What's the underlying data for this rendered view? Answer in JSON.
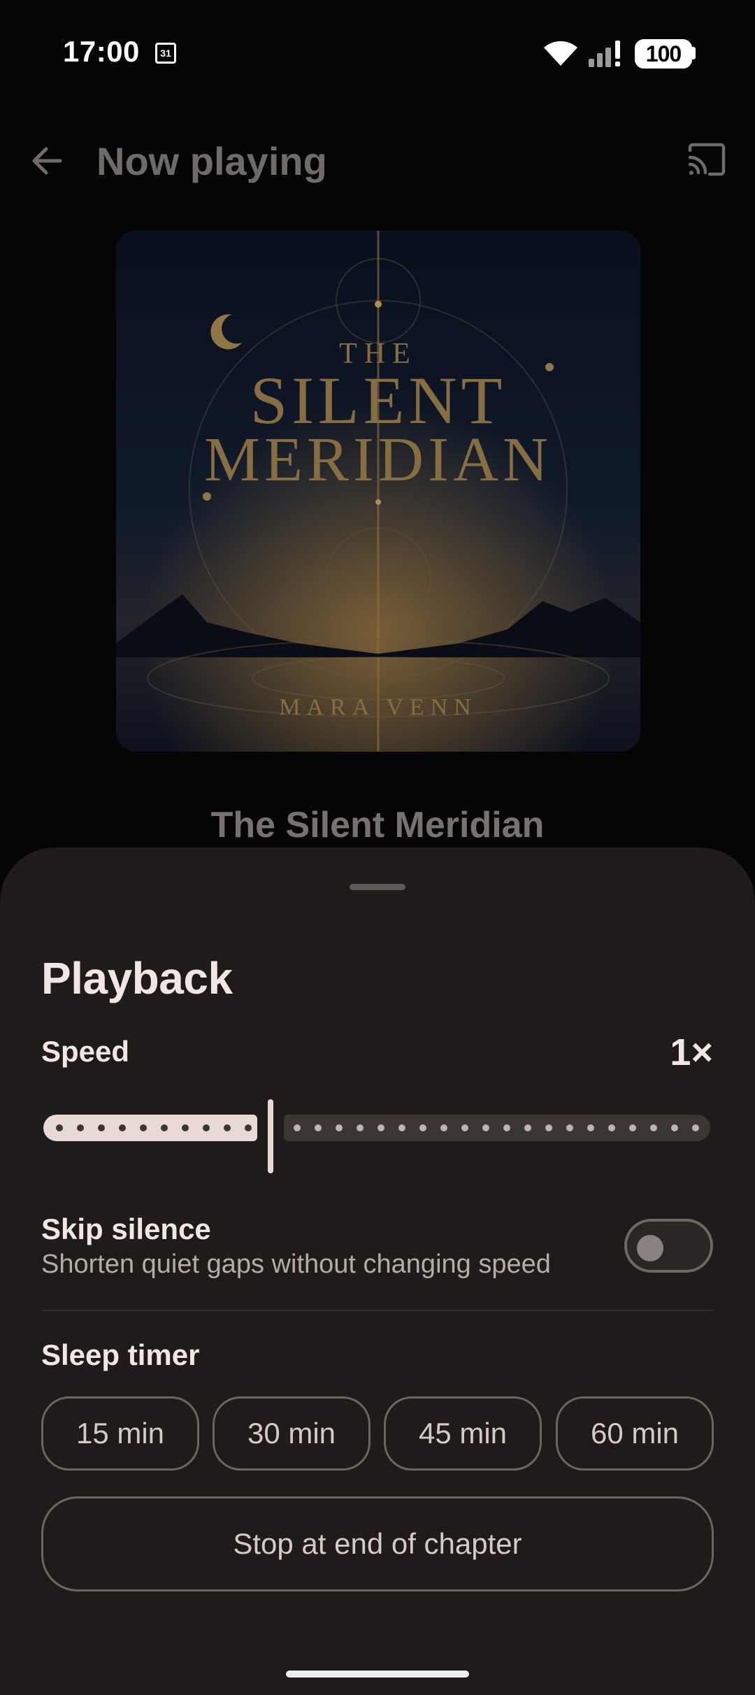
{
  "status_bar": {
    "time": "17:00",
    "calendar_day": "31",
    "battery": "100",
    "icons": [
      "calendar-icon",
      "wifi-icon",
      "signal-icon",
      "battery-icon"
    ]
  },
  "header": {
    "title": "Now playing",
    "back_icon": "arrow-back-icon",
    "cast_icon": "cast-icon"
  },
  "book": {
    "cover_line_1": "THE",
    "cover_line_2": "SILENT",
    "cover_line_3": "MERIDIAN",
    "cover_author": "MARA VENN",
    "title": "The Silent Meridian"
  },
  "playback_sheet": {
    "title": "Playback",
    "speed": {
      "label": "Speed",
      "value_label": "1×",
      "position_fraction": 0.33
    },
    "skip_silence": {
      "label": "Skip silence",
      "description": "Shorten quiet gaps without changing speed",
      "enabled": false
    },
    "sleep_timer": {
      "label": "Sleep timer",
      "options": [
        "15 min",
        "30 min",
        "45 min",
        "60 min"
      ],
      "stop_at_end_label": "Stop at end of chapter"
    }
  },
  "colors": {
    "sheet_background": "#1e1b1a",
    "text_primary": "#f2e6e4",
    "slider_active": "#e8d8d6",
    "slider_inactive": "#3b3634",
    "cover_gold": "#b8955a"
  }
}
